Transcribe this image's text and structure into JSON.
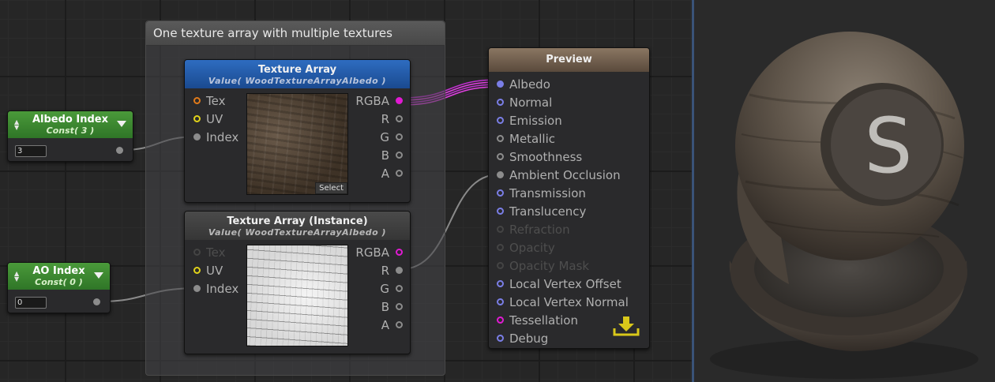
{
  "group": {
    "title": "One texture array with multiple textures"
  },
  "albedo_index": {
    "title": "Albedo Index",
    "subtitle": "Const( 3 )",
    "value": "3"
  },
  "ao_index": {
    "title": "AO Index",
    "subtitle": "Const( 0 )",
    "value": "0"
  },
  "texture_array": {
    "title": "Texture Array",
    "subtitle": "Value( WoodTextureArrayAlbedo )",
    "inputs": [
      "Tex",
      "UV",
      "Index"
    ],
    "outputs": [
      "RGBA",
      "R",
      "G",
      "B",
      "A"
    ],
    "select_label": "Select"
  },
  "texture_array_instance": {
    "title": "Texture Array (Instance)",
    "subtitle": "Value( WoodTextureArrayAlbedo )",
    "inputs": [
      "Tex",
      "UV",
      "Index"
    ],
    "outputs": [
      "RGBA",
      "R",
      "G",
      "B",
      "A"
    ]
  },
  "preview": {
    "title": "Preview",
    "inputs": [
      "Albedo",
      "Normal",
      "Emission",
      "Metallic",
      "Smoothness",
      "Ambient Occlusion",
      "Transmission",
      "Translucency",
      "Refraction",
      "Opacity",
      "Opacity Mask",
      "Local Vertex Offset",
      "Local Vertex Normal",
      "Tessellation",
      "Debug"
    ]
  },
  "viewport": {
    "logo_letter": "S"
  },
  "icons": {
    "download": "download-icon",
    "dropdown": "chevron-down-icon",
    "spinner": "up-down-arrows-icon"
  },
  "colors": {
    "pin_blue": "#7a7ee6",
    "pin_orange": "#e07a1a",
    "pin_yellow": "#e0d21a",
    "pin_magenta": "#e01ad2",
    "const_green": "#3f8f33",
    "texture_header_blue": "#2154a0",
    "divider": "#3a5378"
  }
}
